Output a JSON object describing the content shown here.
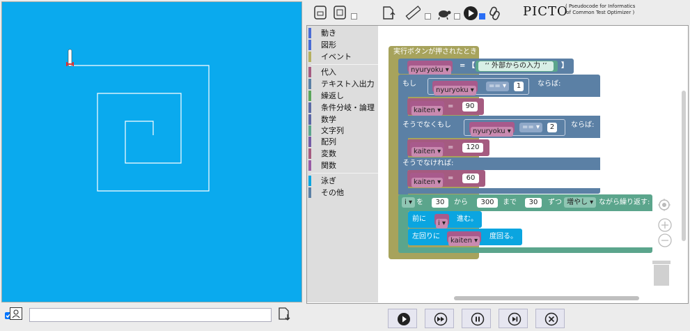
{
  "toolbar": {
    "icons": [
      "save-icon",
      "load-icon",
      "upload-icon",
      "ruler-icon",
      "turtle-icon",
      "run-icon",
      "link-icon"
    ],
    "logo": "PICTO",
    "subtitle_line1": "( Pseudocode for Informatics",
    "subtitle_line2": "of Common Test Optimizer )",
    "checkboxes": [
      false,
      false,
      false,
      true
    ]
  },
  "categories": [
    {
      "label": "動き",
      "color": "#4a6cd4"
    },
    {
      "label": "図形",
      "color": "#4a6cd4"
    },
    {
      "label": "イベント",
      "color": "#b5b060"
    },
    {
      "label": "代入",
      "color": "#a55b80"
    },
    {
      "label": "テキスト入出力",
      "color": "#5b80a5"
    },
    {
      "label": "繰返し",
      "color": "#5ba55b"
    },
    {
      "label": "条件分岐・論理",
      "color": "#5b6ba5"
    },
    {
      "label": "数学",
      "color": "#5b67a5"
    },
    {
      "label": "文字列",
      "color": "#5ba58c"
    },
    {
      "label": "配列",
      "color": "#745ba5"
    },
    {
      "label": "変数",
      "color": "#a55b80"
    },
    {
      "label": "関数",
      "color": "#995ba5"
    },
    {
      "label": "泳ぎ",
      "color": "#0aa5e0"
    },
    {
      "label": "その他",
      "color": "#5b80a5"
    }
  ],
  "program": {
    "hat": "実行ボタンが押されたとき",
    "assign1": {
      "var": "nyuryoku",
      "eq": "=",
      "lbr": "【",
      "input_label": "外部からの入力",
      "rbr": "】"
    },
    "if_label": "もし",
    "cond1": {
      "var": "nyuryoku",
      "op": "==",
      "val": "1"
    },
    "then_label": "ならば:",
    "set1": {
      "var": "kaiten",
      "eq": "=",
      "val": "90"
    },
    "elif_label": "そうでなくもし",
    "cond2": {
      "var": "nyuryoku",
      "op": "==",
      "val": "2"
    },
    "then2_label": "ならば:",
    "set2": {
      "var": "kaiten",
      "eq": "=",
      "val": "120"
    },
    "else_label": "そうでなければ:",
    "set3": {
      "var": "kaiten",
      "eq": "=",
      "val": "60"
    },
    "loop": {
      "var": "i",
      "wo": "を",
      "from": "30",
      "kara": "から",
      "to": "300",
      "made": "まで",
      "step": "30",
      "zutsu": "ずつ",
      "mode": "増やし",
      "suffix": "ながら繰り返す:"
    },
    "forward": {
      "prefix": "前に",
      "var": "i",
      "suffix": "進む。"
    },
    "turn": {
      "prefix": "左回りに",
      "var": "kaiten",
      "suffix": "度回る。"
    }
  },
  "stage": {
    "background": "#0aaaee",
    "spiral": [
      [
        217,
        191
      ],
      [
        217,
        171
      ],
      [
        177,
        171
      ],
      [
        177,
        231
      ],
      [
        257,
        231
      ],
      [
        257,
        131
      ],
      [
        137,
        131
      ],
      [
        137,
        271
      ],
      [
        297,
        271
      ],
      [
        297,
        91
      ],
      [
        97,
        91
      ]
    ]
  },
  "bottom_controls": [
    "run-icon",
    "fast-forward-icon",
    "pause-icon",
    "step-icon",
    "stop-icon"
  ],
  "text_input": {
    "value": "",
    "placeholder": ""
  }
}
